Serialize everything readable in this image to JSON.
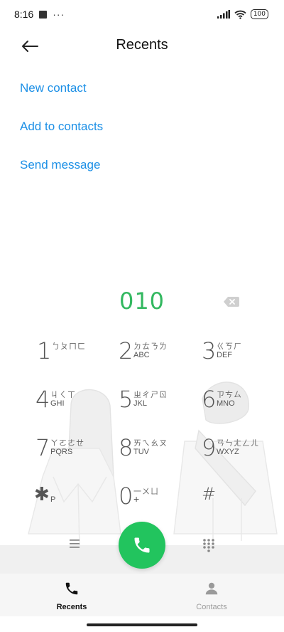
{
  "status_bar": {
    "time": "8:16",
    "dots": "···",
    "battery": "100"
  },
  "header": {
    "title": "Recents"
  },
  "actions": {
    "new_contact": "New contact",
    "add_to_contacts": "Add to contacts",
    "send_message": "Send message"
  },
  "dialer": {
    "number": "010"
  },
  "keypad": {
    "keys": [
      {
        "digit": "1",
        "zhuyin": "ㄅㄆㄇㄈ",
        "letters": ""
      },
      {
        "digit": "2",
        "zhuyin": "ㄉㄊㄋㄌ",
        "letters": "ABC"
      },
      {
        "digit": "3",
        "zhuyin": "ㄍㄎㄏ",
        "letters": "DEF"
      },
      {
        "digit": "4",
        "zhuyin": "ㄐㄑㄒ",
        "letters": "GHI"
      },
      {
        "digit": "5",
        "zhuyin": "ㄓㄔㄕㄖ",
        "letters": "JKL"
      },
      {
        "digit": "6",
        "zhuyin": "ㄗㄘㄙ",
        "letters": "MNO"
      },
      {
        "digit": "7",
        "zhuyin": "ㄚㄛㄜㄝ",
        "letters": "PQRS"
      },
      {
        "digit": "8",
        "zhuyin": "ㄞㄟㄠㄡ",
        "letters": "TUV"
      },
      {
        "digit": "9",
        "zhuyin": "ㄢㄣㄤㄥㄦ",
        "letters": "WXYZ"
      },
      {
        "digit": "✱",
        "zhuyin": "",
        "letters": "P"
      },
      {
        "digit": "0",
        "zhuyin": "一ㄨㄩ",
        "letters": "+"
      },
      {
        "digit": "#",
        "zhuyin": "",
        "letters": ""
      }
    ]
  },
  "bottom_nav": {
    "tabs": [
      {
        "label": "Recents",
        "icon": "phone-icon",
        "active": true
      },
      {
        "label": "Contacts",
        "icon": "person-icon",
        "active": false
      }
    ]
  },
  "colors": {
    "link": "#1b8fe6",
    "number": "#33b860",
    "call": "#22c45e"
  }
}
